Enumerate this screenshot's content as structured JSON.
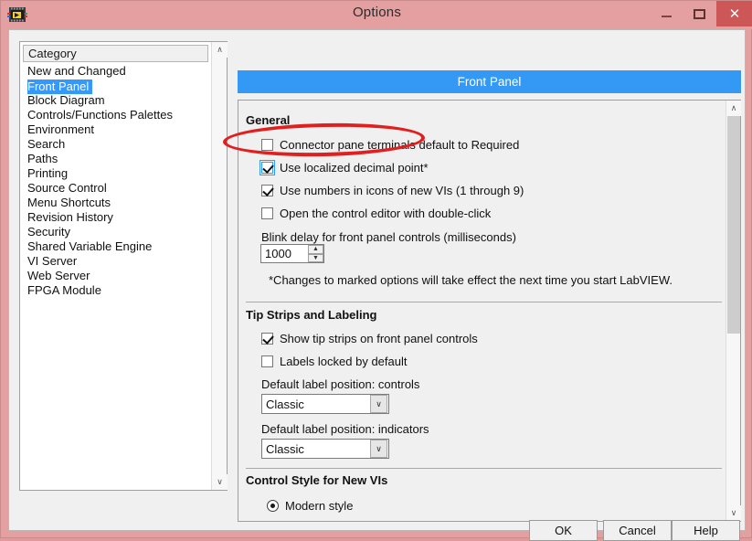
{
  "window": {
    "title": "Options",
    "icon": "labview-vi-icon",
    "controls": {
      "minimize": "–",
      "maximize": "❐",
      "close": "✕"
    },
    "colors": {
      "titlebar": "#e4a0a0",
      "close_button": "#cd5757",
      "banner": "#3399f5",
      "selection": "#3399ff",
      "annotation": "#e21f1f"
    }
  },
  "sidebar": {
    "header": "Category",
    "selected": "Front Panel",
    "items": [
      {
        "label": "New and Changed"
      },
      {
        "label": "Front Panel"
      },
      {
        "label": "Block Diagram"
      },
      {
        "label": "Controls/Functions Palettes"
      },
      {
        "label": "Environment"
      },
      {
        "label": "Search"
      },
      {
        "label": "Paths"
      },
      {
        "label": "Printing"
      },
      {
        "label": "Source Control"
      },
      {
        "label": "Menu Shortcuts"
      },
      {
        "label": "Revision History"
      },
      {
        "label": "Security"
      },
      {
        "label": "Shared Variable Engine"
      },
      {
        "label": "VI Server"
      },
      {
        "label": "Web Server"
      },
      {
        "label": "FPGA Module"
      }
    ],
    "scrollbar": {
      "up_arrow": "∧",
      "down_arrow": "∨"
    }
  },
  "banner": {
    "title": "Front Panel"
  },
  "content": {
    "sections": [
      {
        "title": "General",
        "checkboxes": [
          {
            "label": "Connector pane terminals default to Required",
            "checked": false,
            "focused": false
          },
          {
            "label": "Use localized decimal point*",
            "checked": true,
            "focused": true
          },
          {
            "label": "Use numbers in icons of new VIs (1 through 9)",
            "checked": true,
            "focused": false
          },
          {
            "label": "Open the control editor with double-click",
            "checked": false,
            "focused": false
          }
        ],
        "spinner_label": "Blink delay for front panel controls (milliseconds)",
        "spinner_value": "1000",
        "spinner_up": "▲",
        "spinner_down": "▼",
        "footnote": "*Changes to marked options will take effect the next time you start LabVIEW."
      },
      {
        "title": "Tip Strips and Labeling",
        "checkboxes": [
          {
            "label": "Show tip strips on front panel controls",
            "checked": true,
            "focused": false
          },
          {
            "label": "Labels locked by default",
            "checked": false,
            "focused": false
          }
        ],
        "combo_label_controls": "Default label position: controls",
        "combo_value_controls": "Classic",
        "combo_label_indicators": "Default label position: indicators",
        "combo_value_indicators": "Classic",
        "combo_arrow": "∨"
      },
      {
        "title": "Control Style for New VIs",
        "radio_label": "Modern style",
        "radio_selected": true
      }
    ],
    "scrollbar": {
      "up_arrow": "∧",
      "down_arrow": "∨"
    }
  },
  "footer": {
    "ok": "OK",
    "cancel": "Cancel",
    "help": "Help"
  }
}
